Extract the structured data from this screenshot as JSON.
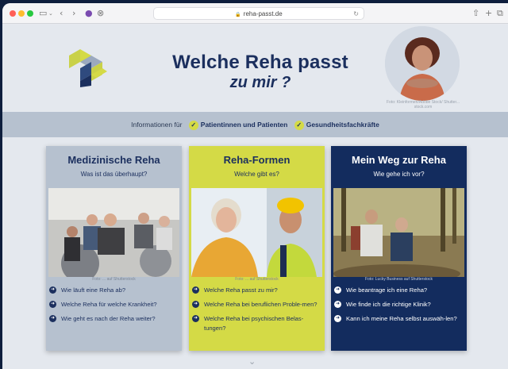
{
  "browser": {
    "url": "reha-passt.de",
    "lock_icon": "lock-icon"
  },
  "hero": {
    "title": "Welche Reha passt",
    "subtitle": "zu mir ?",
    "portrait_credit": "Foto: Kleinformen/Adobe Stock/ Shutter... stock.com"
  },
  "infobar": {
    "prefix": "Informationen für",
    "audience_1": "Patientinnen und Patienten",
    "audience_2": "Gesundheitsfachkräfte"
  },
  "cards": [
    {
      "title": "Medizinische Reha",
      "subtitle": "Was ist das überhaupt?",
      "photo_credit": "Foto: ... auf Shutterstock",
      "links": [
        "Wie läuft eine Reha ab?",
        "Welche Reha für welche Krankheit?",
        "Wie geht es nach der Reha weiter?"
      ]
    },
    {
      "title": "Reha-Formen",
      "subtitle": "Welche gibt es?",
      "photo_credit": "Foto: ... auf Shutterstock",
      "links": [
        "Welche Reha passt zu mir?",
        "Welche Reha bei beruflichen Proble-men?",
        "Welche Reha bei psychischen Belas-tungen?"
      ]
    },
    {
      "title": "Mein Weg zur Reha",
      "subtitle": "Wie gehe ich vor?",
      "photo_credit": "Foto: Lucky Business auf Shutterstock",
      "links": [
        "Wie beantrage ich eine Reha?",
        "Wie finde ich die richtige Klinik?",
        "Kann ich meine Reha selbst auswäh-len?"
      ]
    }
  ],
  "colors": {
    "navy": "#1b2f5e",
    "lime": "#d4da46",
    "grey_blue": "#b6c1cf",
    "dark_navy": "#132c5e"
  }
}
